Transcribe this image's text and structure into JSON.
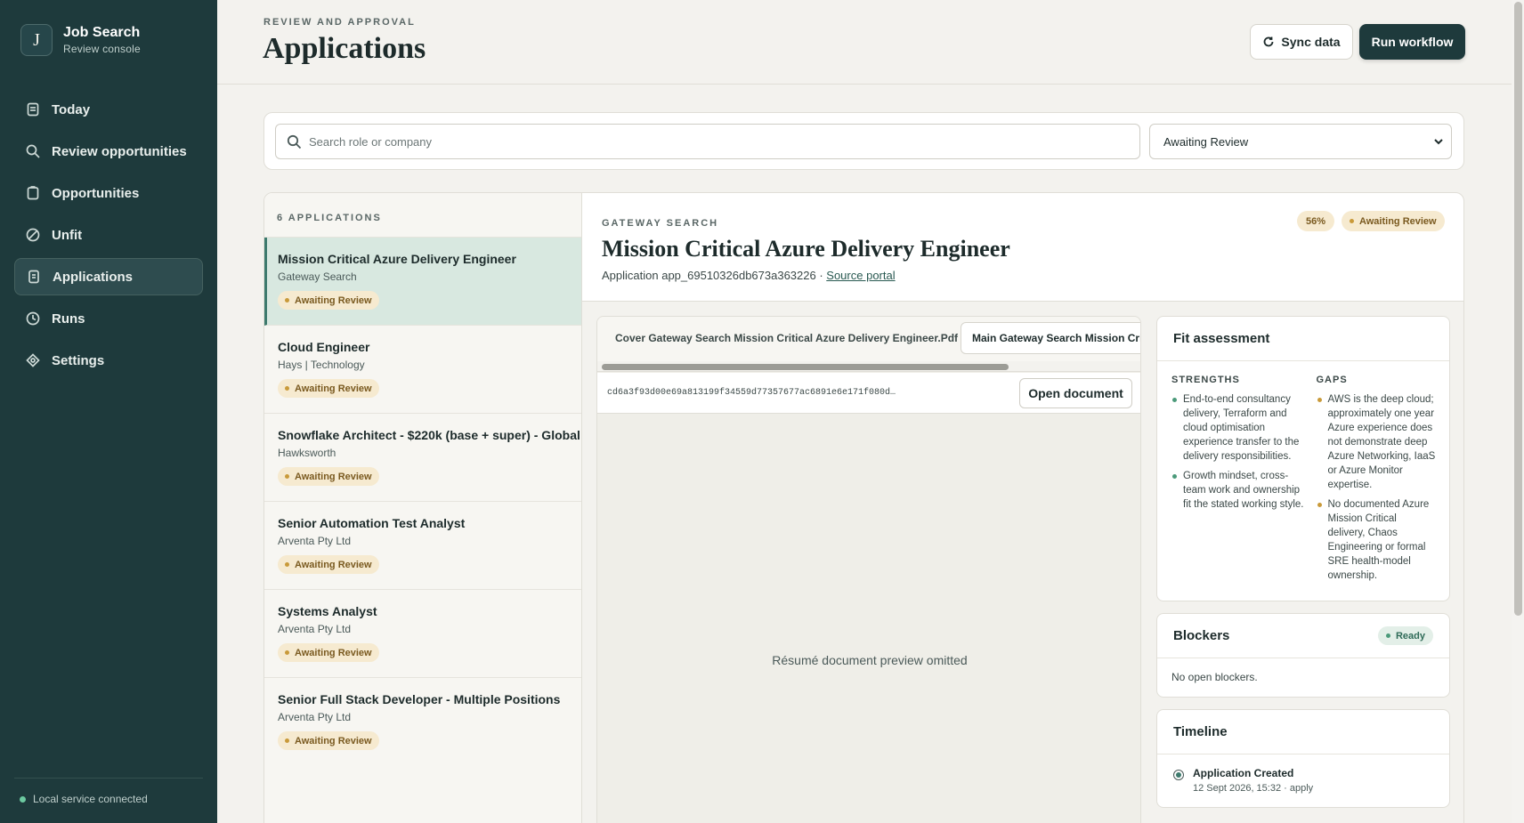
{
  "sidebar": {
    "brand_letter": "J",
    "brand_title": "Job Search",
    "brand_subtitle": "Review console",
    "items": [
      {
        "label": "Today",
        "icon": "calendar-icon"
      },
      {
        "label": "Review opportunities",
        "icon": "search-icon"
      },
      {
        "label": "Opportunities",
        "icon": "clipboard-icon"
      },
      {
        "label": "Unfit",
        "icon": "ban-icon"
      },
      {
        "label": "Applications",
        "icon": "document-icon",
        "active": true
      },
      {
        "label": "Runs",
        "icon": "clock-icon"
      },
      {
        "label": "Settings",
        "icon": "diamond-icon"
      }
    ],
    "footer_status": "Local service connected"
  },
  "header": {
    "eyebrow": "REVIEW AND APPROVAL",
    "title": "Applications",
    "sync_label": "Sync data",
    "run_label": "Run workflow"
  },
  "filters": {
    "search_placeholder": "Search role or company",
    "search_value": "",
    "status_selected": "Awaiting Review"
  },
  "list": {
    "count_label": "6 APPLICATIONS",
    "items": [
      {
        "title": "Mission Critical Azure Delivery Engineer",
        "company": "Gateway Search",
        "status": "Awaiting Review"
      },
      {
        "title": "Cloud Engineer",
        "company": "Hays | Technology",
        "status": "Awaiting Review"
      },
      {
        "title": "Snowflake Architect - $220k (base + super) - Global",
        "company": "Hawksworth",
        "status": "Awaiting Review"
      },
      {
        "title": "Senior Automation Test Analyst",
        "company": "Arventa Pty Ltd",
        "status": "Awaiting Review"
      },
      {
        "title": "Systems Analyst",
        "company": "Arventa Pty Ltd",
        "status": "Awaiting Review"
      },
      {
        "title": "Senior Full Stack Developer - Multiple Positions",
        "company": "Arventa Pty Ltd",
        "status": "Awaiting Review"
      }
    ]
  },
  "detail": {
    "company": "GATEWAY SEARCH",
    "title": "Mission Critical Azure Delivery Engineer",
    "application_prefix": "Application app_69510326db673a363226 · ",
    "source_link": "Source portal",
    "score": "56%",
    "status": "Awaiting Review",
    "tabs": [
      "Cover Gateway Search Mission Critical Azure Delivery Engineer.Pdf",
      "Main Gateway Search Mission Critical Azure Delivery Engineer.Pdf"
    ],
    "document_hash": "cd6a3f93d00e69a813199f34559d77357677ac6891e6e171f080d…",
    "open_document_label": "Open document",
    "preview_text": "Résumé document preview omitted"
  },
  "fit": {
    "title": "Fit assessment",
    "strengths_label": "STRENGTHS",
    "gaps_label": "GAPS",
    "strengths": [
      "End-to-end consultancy delivery, Terraform and cloud optimisation experience transfer to the delivery responsibilities.",
      "Growth mindset, cross-team work and ownership fit the stated working style."
    ],
    "gaps": [
      "AWS is the deep cloud; approximately one year Azure experience does not demonstrate deep Azure Networking, IaaS or Azure Monitor expertise.",
      "No documented Azure Mission Critical delivery, Chaos Engineering or formal SRE health-model ownership."
    ]
  },
  "blockers": {
    "title": "Blockers",
    "status": "Ready",
    "text": "No open blockers."
  },
  "timeline": {
    "title": "Timeline",
    "event_title": "Application Created",
    "event_meta": "12 Sept 2026, 15:32 · apply"
  }
}
